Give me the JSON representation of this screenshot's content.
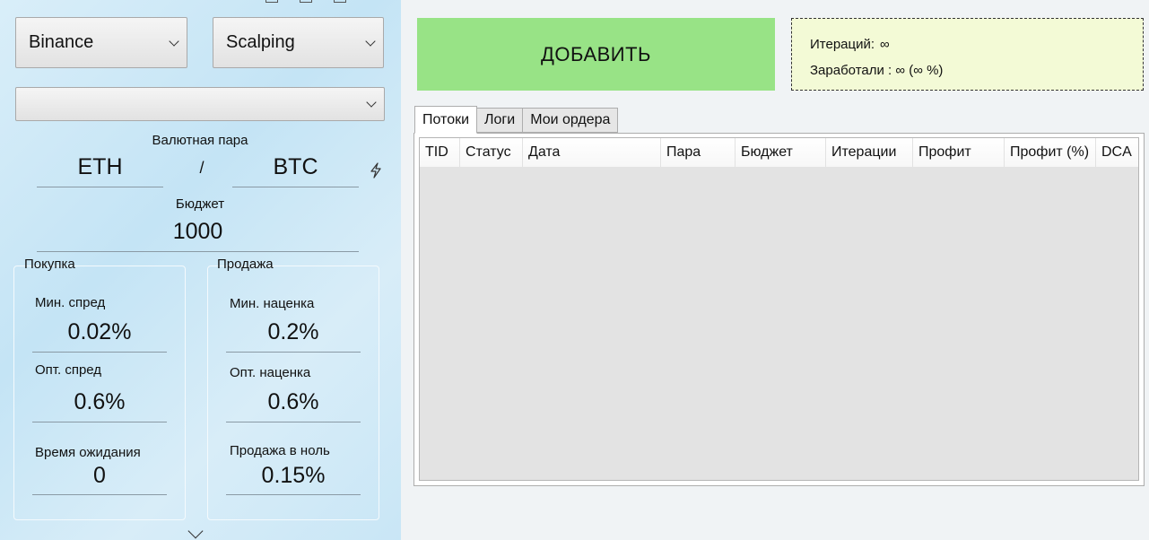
{
  "left": {
    "exchange_select": "Binance",
    "strategy_select": "Scalping",
    "extra_select": "",
    "pair_label": "Валютная пара",
    "base_currency": "ETH",
    "pair_separator": "/",
    "quote_currency": "BTC",
    "budget_label": "Бюджет",
    "budget_value": "1000",
    "buy": {
      "title": "Покупка",
      "min_spread_label": "Мин. спред",
      "min_spread_value": "0.02%",
      "opt_spread_label": "Опт. спред",
      "opt_spread_value": "0.6%",
      "wait_label": "Время ожидания",
      "wait_value": "0"
    },
    "sell": {
      "title": "Продажа",
      "min_markup_label": "Мин. наценка",
      "min_markup_value": "0.2%",
      "opt_markup_label": "Опт. наценка",
      "opt_markup_value": "0.6%",
      "zero_sell_label": "Продажа в ноль",
      "zero_sell_value": "0.15%"
    }
  },
  "add_button": "ДОБАВИТЬ",
  "stats": {
    "iterations_label": "Итераций:",
    "iterations_value": "∞",
    "earned_text": "Заработали : ∞ (∞ %)"
  },
  "tabs": [
    {
      "label": "Потоки",
      "active": true
    },
    {
      "label": "Логи",
      "active": false
    },
    {
      "label": "Мои ордера",
      "active": false
    }
  ],
  "table": {
    "columns": [
      "TID",
      "Статус",
      "Дата",
      "Пара",
      "Бюджет",
      "Итерации",
      "Профит",
      "Профит (%)",
      "DCA"
    ],
    "rows": []
  },
  "colors": {
    "add_button": "#98e386",
    "stats_bg": "#f3fad6",
    "left_panel": "#d2eaf7"
  }
}
